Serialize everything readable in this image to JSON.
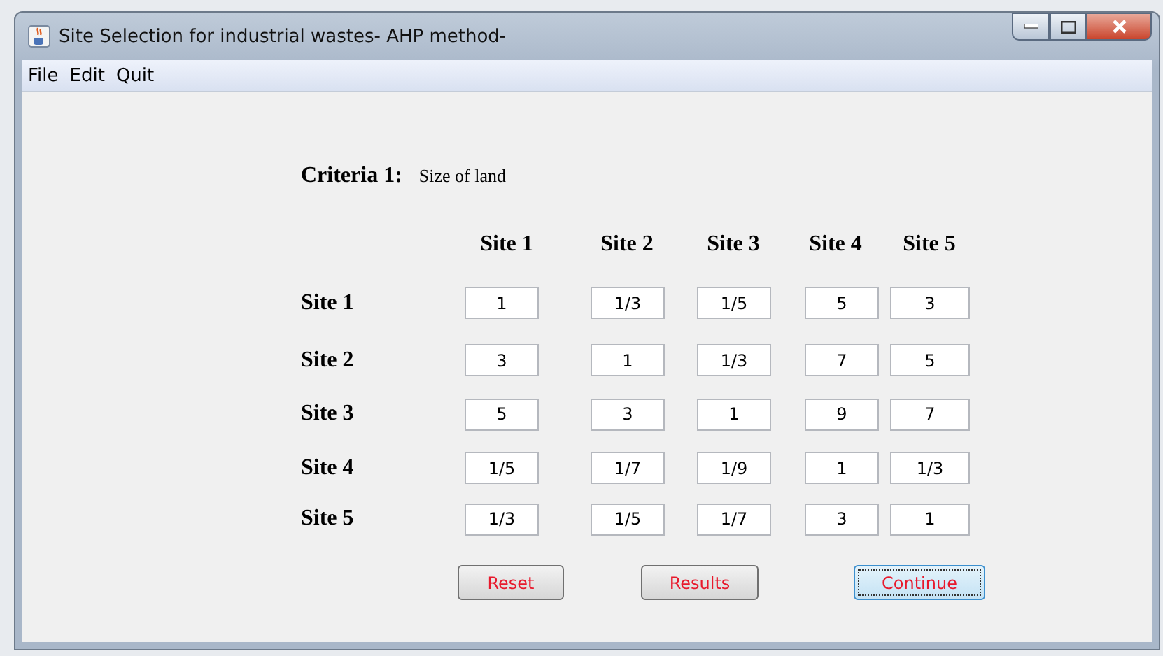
{
  "window": {
    "title": "Site Selection for industrial wastes- AHP method-"
  },
  "menu": [
    "File",
    "Edit",
    "Quit"
  ],
  "criteria": {
    "label": "Criteria 1:",
    "value": "Size of land"
  },
  "columns": [
    "Site 1",
    "Site 2",
    "Site 3",
    "Site 4",
    "Site 5"
  ],
  "rows": [
    {
      "label": "Site 1",
      "cells": [
        "1",
        "1/3",
        "1/5",
        "5",
        "3"
      ]
    },
    {
      "label": "Site 2",
      "cells": [
        "3",
        "1",
        "1/3",
        "7",
        "5"
      ]
    },
    {
      "label": "Site 3",
      "cells": [
        "5",
        "3",
        "1",
        "9",
        "7"
      ]
    },
    {
      "label": "Site 4",
      "cells": [
        "1/5",
        "1/7",
        "1/9",
        "1",
        "1/3"
      ]
    },
    {
      "label": "Site 5",
      "cells": [
        "1/3",
        "1/5",
        "1/7",
        "3",
        "1"
      ]
    }
  ],
  "buttons": [
    {
      "label": "Reset",
      "focused": false
    },
    {
      "label": "Results",
      "focused": false
    },
    {
      "label": "Continue",
      "focused": true
    }
  ]
}
